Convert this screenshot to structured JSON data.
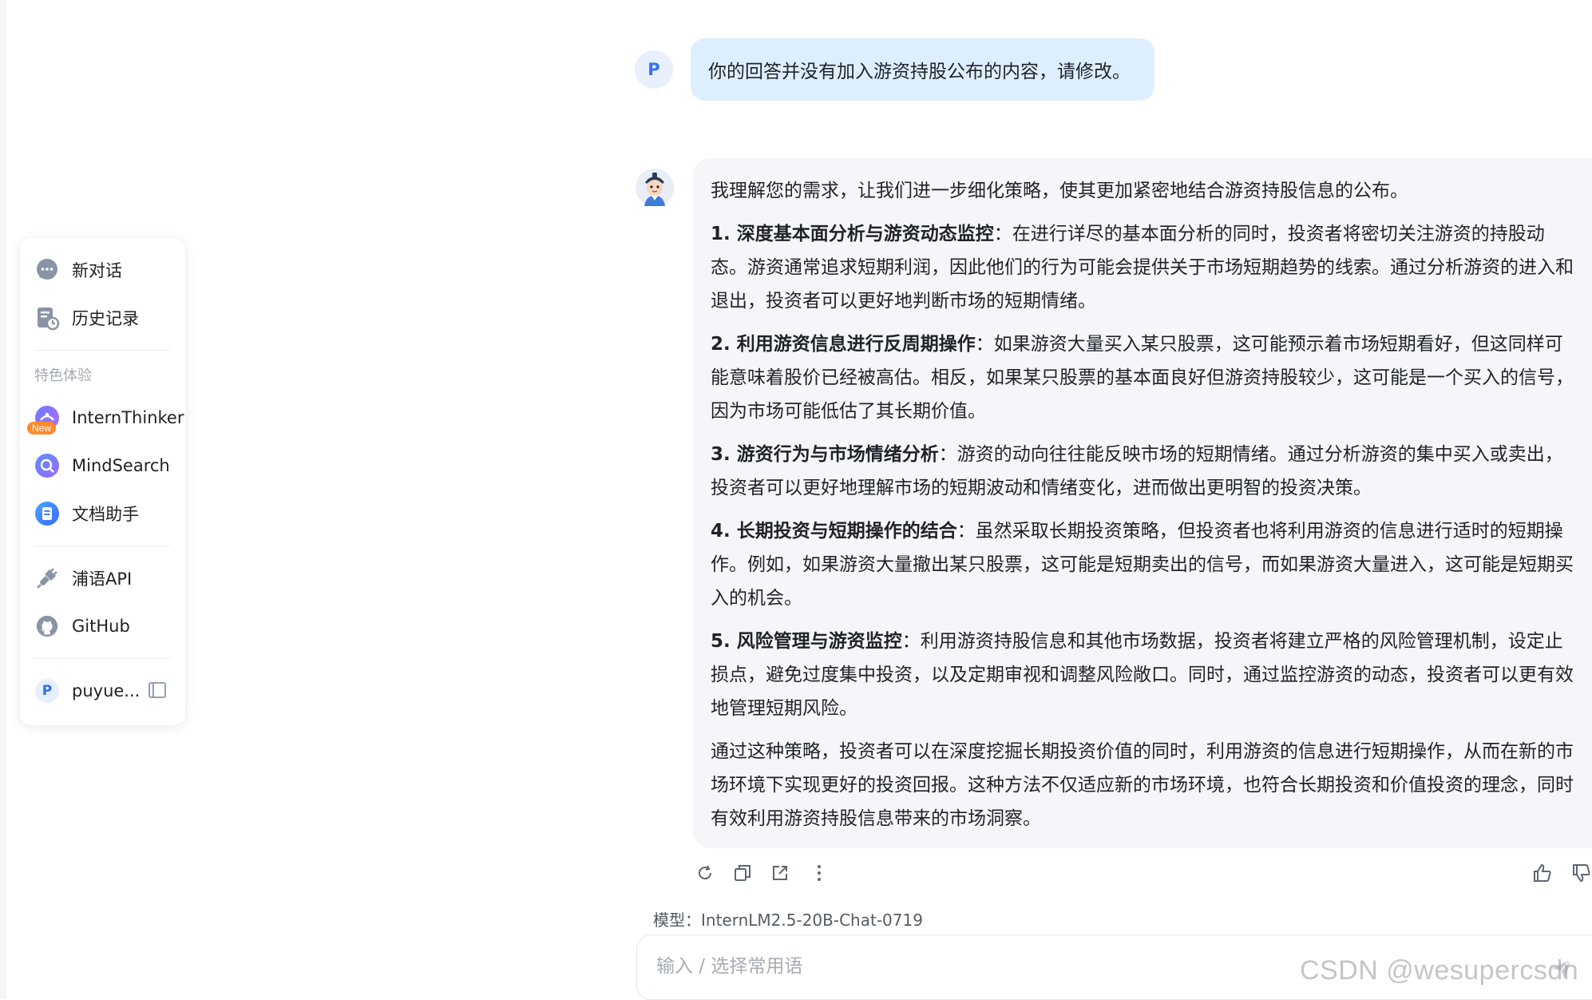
{
  "sidebar": {
    "new_chat": "新对话",
    "history": "历史记录",
    "section_label": "特色体验",
    "features": [
      {
        "label": "InternThinker",
        "badge": "New"
      },
      {
        "label": "MindSearch"
      },
      {
        "label": "文档助手"
      }
    ],
    "api": "浦语API",
    "github": "GitHub",
    "user_initial": "P",
    "user_name": "puyue..."
  },
  "chat": {
    "user_initial": "P",
    "user_message": "你的回答并没有加入游资持股公布的内容，请修改。",
    "assistant": {
      "intro": "我理解您的需求，让我们进一步细化策略，使其更加紧密地结合游资持股信息的公布。",
      "points": [
        {
          "title": "1. 深度基本面分析与游资动态监控",
          "text": "：在进行详尽的基本面分析的同时，投资者将密切关注游资的持股动态。游资通常追求短期利润，因此他们的行为可能会提供关于市场短期趋势的线索。通过分析游资的进入和退出，投资者可以更好地判断市场的短期情绪。"
        },
        {
          "title": "2. 利用游资信息进行反周期操作",
          "text": "：如果游资大量买入某只股票，这可能预示着市场短期看好，但这同样可能意味着股价已经被高估。相反，如果某只股票的基本面良好但游资持股较少，这可能是一个买入的信号，因为市场可能低估了其长期价值。"
        },
        {
          "title": "3. 游资行为与市场情绪分析",
          "text": "：游资的动向往往能反映市场的短期情绪。通过分析游资的集中买入或卖出，投资者可以更好地理解市场的短期波动和情绪变化，进而做出更明智的投资决策。"
        },
        {
          "title": "4. 长期投资与短期操作的结合",
          "text": "：虽然采取长期投资策略，但投资者也将利用游资的信息进行适时的短期操作。例如，如果游资大量撤出某只股票，这可能是短期卖出的信号，而如果游资大量进入，这可能是短期买入的机会。"
        },
        {
          "title": "5. 风险管理与游资监控",
          "text": "：利用游资持股信息和其他市场数据，投资者将建立严格的风险管理机制，设定止损点，避免过度集中投资，以及定期审视和调整风险敞口。同时，通过监控游资的动态，投资者可以更有效地管理短期风险。"
        }
      ],
      "conclusion": "通过这种策略，投资者可以在深度挖掘长期投资价值的同时，利用游资的信息进行短期操作，从而在新的市场环境下实现更好的投资回报。这种方法不仅适应新的市场环境，也符合长期投资和价值投资的理念，同时有效利用游资持股信息带来的市场洞察。"
    },
    "model_label": "模型：InternLM2.5-20B-Chat-0719",
    "input_placeholder": "输入 / 选择常用语"
  },
  "watermark": "CSDN @wesupercsdn",
  "colors": {
    "user_bubble": "#ddeeff",
    "assistant_bubble": "#f4f6f9",
    "accent": "#2e6cf0",
    "badge": "#ff8a2a"
  }
}
